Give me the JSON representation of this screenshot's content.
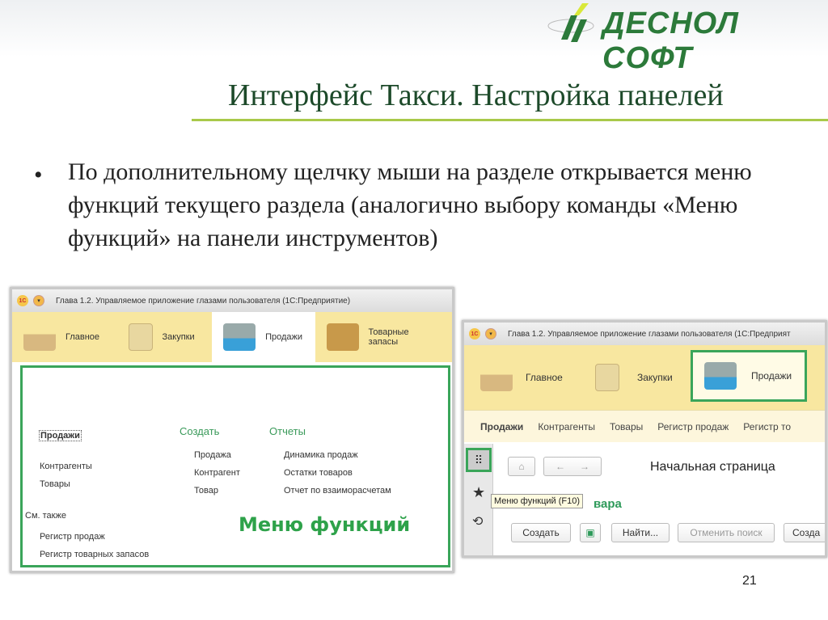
{
  "logo": {
    "text": "ДЕСНОЛ СОФТ"
  },
  "slide": {
    "title": "Интерфейс Такси. Настройка панелей",
    "bullet": "По дополнительному щелчку мыши на разделе открывается меню функций текущего раздела (аналогично выбору команды «Меню функций» на панели инструментов)",
    "page_number": "21"
  },
  "shot1": {
    "window_title": "Глава 1.2. Управляемое приложение глазами пользователя  (1С:Предприятие)",
    "tabs": [
      "Главное",
      "Закупки",
      "Продажи",
      "Товарные запасы"
    ],
    "nav": [
      "Продажи",
      "Контрагенты",
      "Товары"
    ],
    "see_also_label": "См. также",
    "see_also": [
      "Регистр продаж",
      "Регистр товарных запасов"
    ],
    "create_label": "Создать",
    "create": [
      "Продажа",
      "Контрагент",
      "Товар"
    ],
    "reports_label": "Отчеты",
    "reports": [
      "Динамика продаж",
      "Остатки товаров",
      "Отчет по взаиморасчетам"
    ],
    "caption": "Меню функций"
  },
  "shot2": {
    "window_title": "Глава 1.2. Управляемое приложение глазами пользователя  (1С:Предприят",
    "tabs": [
      "Главное",
      "Закупки",
      "Продажи"
    ],
    "section_bar": [
      "Продажи",
      "Контрагенты",
      "Товары",
      "Регистр продаж",
      "Регистр то"
    ],
    "page_title": "Начальная страница",
    "tooltip": "Меню функций (F10)",
    "list_title_fragment": "вара",
    "buttons": {
      "create": "Создать",
      "find": "Найти...",
      "cancel_search": "Отменить поиск",
      "create2": "Созда"
    }
  }
}
